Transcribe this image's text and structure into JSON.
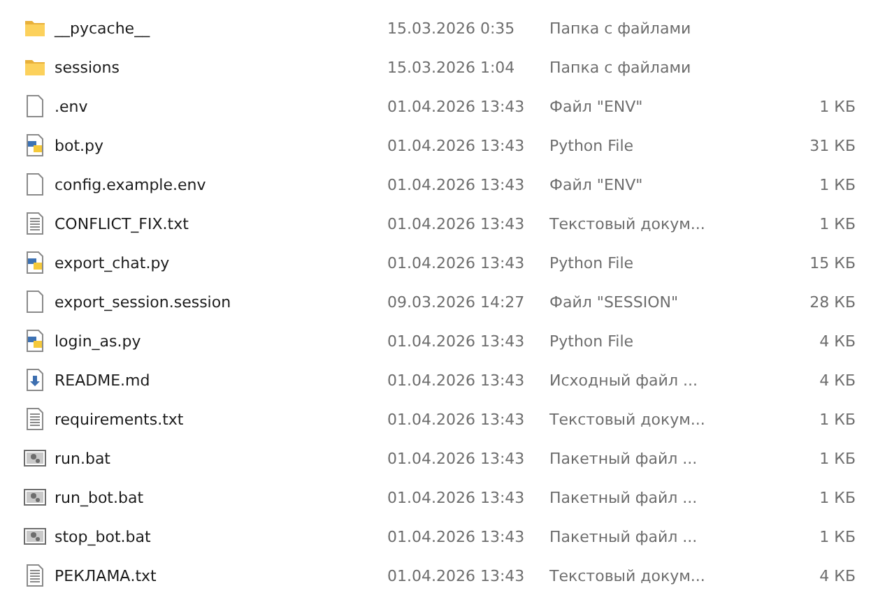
{
  "files": [
    {
      "kind": "folder",
      "name": "__pycache__",
      "modified": "15.03.2026 0:35",
      "type": "Папка с файлами"
    },
    {
      "kind": "folder",
      "name": "sessions",
      "modified": "15.03.2026 1:04",
      "type": "Папка с файлами"
    },
    {
      "kind": "file",
      "name": ".env",
      "modified": "01.04.2026 13:43",
      "type": "Файл \"ENV\"",
      "size": "1 КБ"
    },
    {
      "kind": "python",
      "name": "bot.py",
      "modified": "01.04.2026 13:43",
      "type": "Python File",
      "size": "31 КБ"
    },
    {
      "kind": "file",
      "name": "config.example.env",
      "modified": "01.04.2026 13:43",
      "type": "Файл \"ENV\"",
      "size": "1 КБ"
    },
    {
      "kind": "text",
      "name": "CONFLICT_FIX.txt",
      "modified": "01.04.2026 13:43",
      "type": "Текстовый докум...",
      "size": "1 КБ"
    },
    {
      "kind": "python",
      "name": "export_chat.py",
      "modified": "01.04.2026 13:43",
      "type": "Python File",
      "size": "15 КБ"
    },
    {
      "kind": "file",
      "name": "export_session.session",
      "modified": "09.03.2026 14:27",
      "type": "Файл \"SESSION\"",
      "size": "28 КБ"
    },
    {
      "kind": "python",
      "name": "login_as.py",
      "modified": "01.04.2026 13:43",
      "type": "Python File",
      "size": "4 КБ"
    },
    {
      "kind": "markdown",
      "name": "README.md",
      "modified": "01.04.2026 13:43",
      "type": "Исходный файл ...",
      "size": "4 КБ"
    },
    {
      "kind": "text",
      "name": "requirements.txt",
      "modified": "01.04.2026 13:43",
      "type": "Текстовый докум...",
      "size": "1 КБ"
    },
    {
      "kind": "batch",
      "name": "run.bat",
      "modified": "01.04.2026 13:43",
      "type": "Пакетный файл ...",
      "size": "1 КБ"
    },
    {
      "kind": "batch",
      "name": "run_bot.bat",
      "modified": "01.04.2026 13:43",
      "type": "Пакетный файл ...",
      "size": "1 КБ"
    },
    {
      "kind": "batch",
      "name": "stop_bot.bat",
      "modified": "01.04.2026 13:43",
      "type": "Пакетный файл ...",
      "size": "1 КБ"
    },
    {
      "kind": "text",
      "name": "РЕКЛАМА.txt",
      "modified": "01.04.2026 13:43",
      "type": "Текстовый докум...",
      "size": "4 КБ"
    }
  ]
}
